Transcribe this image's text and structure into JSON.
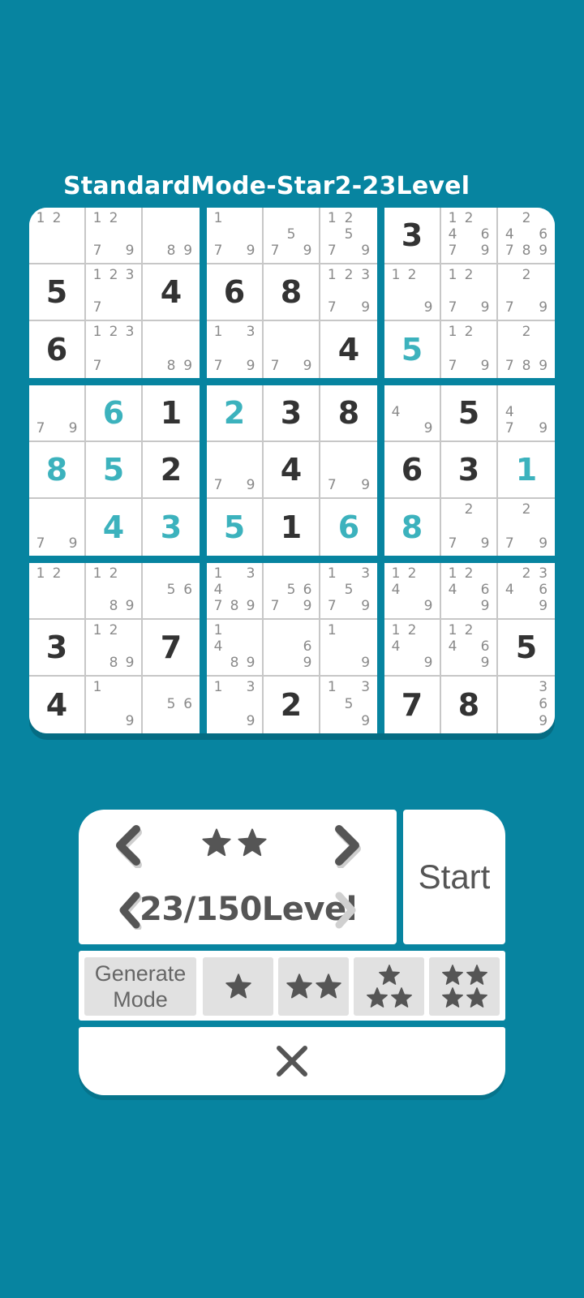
{
  "title": "StandardMode-Star2-23Level",
  "colors": {
    "background": "#0784A0",
    "given": "#333333",
    "user": "#3cb2bd",
    "note": "#8a8a8a"
  },
  "board": [
    [
      {
        "n": "12"
      },
      {
        "n": "1279"
      },
      {
        "n": "89"
      },
      {
        "n": "179"
      },
      {
        "n": "579"
      },
      {
        "n": "12579"
      },
      {
        "g": "3"
      },
      {
        "n": "124679"
      },
      {
        "n": "246789"
      }
    ],
    [
      {
        "g": "5"
      },
      {
        "n": "1237"
      },
      {
        "g": "4"
      },
      {
        "g": "6"
      },
      {
        "g": "8"
      },
      {
        "n": "12379"
      },
      {
        "n": "129"
      },
      {
        "n": "1279"
      },
      {
        "n": "279"
      }
    ],
    [
      {
        "g": "6"
      },
      {
        "n": "1237"
      },
      {
        "n": "89"
      },
      {
        "n": "1379"
      },
      {
        "n": "79"
      },
      {
        "g": "4"
      },
      {
        "u": "5"
      },
      {
        "n": "1279"
      },
      {
        "n": "2789"
      }
    ],
    [
      {
        "n": "79"
      },
      {
        "u": "6"
      },
      {
        "g": "1"
      },
      {
        "u": "2"
      },
      {
        "g": "3"
      },
      {
        "g": "8"
      },
      {
        "n": "49"
      },
      {
        "g": "5"
      },
      {
        "n": "479"
      }
    ],
    [
      {
        "u": "8"
      },
      {
        "u": "5"
      },
      {
        "g": "2"
      },
      {
        "n": "79"
      },
      {
        "g": "4"
      },
      {
        "n": "79"
      },
      {
        "g": "6"
      },
      {
        "g": "3"
      },
      {
        "u": "1"
      }
    ],
    [
      {
        "n": "79"
      },
      {
        "u": "4"
      },
      {
        "u": "3"
      },
      {
        "u": "5"
      },
      {
        "g": "1"
      },
      {
        "u": "6"
      },
      {
        "u": "8"
      },
      {
        "n": "279"
      },
      {
        "n": "279"
      }
    ],
    [
      {
        "n": "12"
      },
      {
        "n": "1289"
      },
      {
        "n": "56"
      },
      {
        "n": "134789"
      },
      {
        "n": "5679"
      },
      {
        "n": "13579"
      },
      {
        "n": "1249"
      },
      {
        "n": "12469"
      },
      {
        "n": "23469"
      }
    ],
    [
      {
        "g": "3"
      },
      {
        "n": "1289"
      },
      {
        "g": "7"
      },
      {
        "n": "1489"
      },
      {
        "n": "69"
      },
      {
        "n": "19"
      },
      {
        "n": "1249"
      },
      {
        "n": "12469"
      },
      {
        "g": "5"
      }
    ],
    [
      {
        "g": "4"
      },
      {
        "n": "19"
      },
      {
        "n": "56"
      },
      {
        "n": "139"
      },
      {
        "g": "2"
      },
      {
        "n": "1359"
      },
      {
        "g": "7"
      },
      {
        "g": "8"
      },
      {
        "n": "369"
      }
    ]
  ],
  "selector": {
    "difficulty_stars": 2,
    "level_text": "23/150Level"
  },
  "start_label": "Start",
  "generate_mode_line1": "Generate",
  "generate_mode_line2": "Mode",
  "mode_buttons": [
    1,
    2,
    3,
    4
  ],
  "icons": [
    "chevron-left-icon",
    "chevron-right-icon",
    "star-icon",
    "close-icon"
  ]
}
